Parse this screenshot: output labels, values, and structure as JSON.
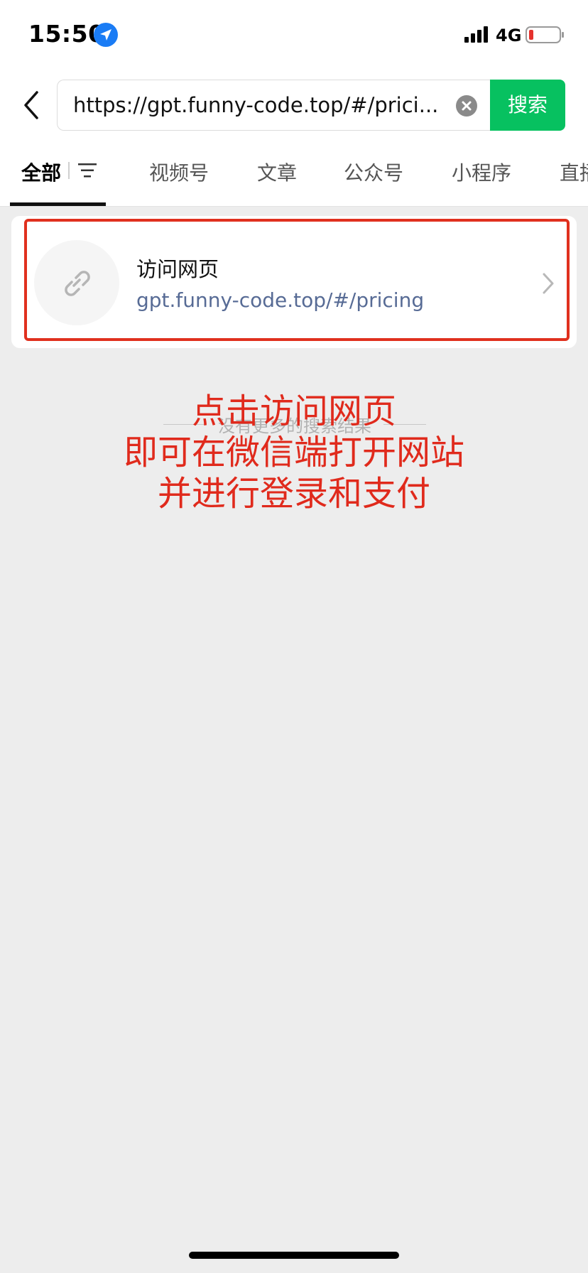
{
  "status_bar": {
    "time": "15:50",
    "network": "4G",
    "battery_color": "#e5322d"
  },
  "search": {
    "query": "https://gpt.funny-code.top/#/prici...",
    "button_label": "搜索",
    "accent_color": "#07c160"
  },
  "tabs": [
    {
      "label": "全部",
      "active": true
    },
    {
      "label": "视频号",
      "active": false
    },
    {
      "label": "文章",
      "active": false
    },
    {
      "label": "公众号",
      "active": false
    },
    {
      "label": "小程序",
      "active": false
    },
    {
      "label": "直播",
      "active": false
    }
  ],
  "result": {
    "title": "访问网页",
    "url": "gpt.funny-code.top/#/pricing",
    "icon": "link-icon"
  },
  "footer_note": "没有更多的搜索结果",
  "annotation": {
    "lines": [
      "点击访问网页",
      "即可在微信端打开网站",
      "并进行登录和支付"
    ],
    "color": "#e02a1c"
  }
}
